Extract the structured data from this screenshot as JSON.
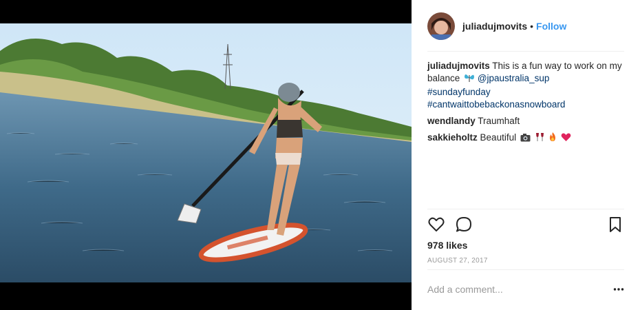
{
  "post": {
    "image_alt": "Woman standing on a paddle board on a lake",
    "author": {
      "username": "juliadujmovits",
      "separator": "•",
      "follow_label": "Follow"
    },
    "caption": {
      "username": "juliadujmovits",
      "text": "This is a fun way to work on my balance",
      "emoji_icon": "butterfly-emoji",
      "mention": "@jpaustralia_sup",
      "hashtags": [
        "#sundayfunday",
        "#cantwaittobebackonasnowboard"
      ]
    },
    "comments": [
      {
        "username": "wendlandy",
        "text": "Traumhaft",
        "emojis": []
      },
      {
        "username": "sakkieholtz",
        "text": "Beautiful",
        "emojis": [
          "camera-flash-emoji",
          "wine-emoji",
          "fire-emoji",
          "heart-emoji"
        ]
      }
    ],
    "actions": {
      "like_icon": "heart-outline-icon",
      "comment_icon": "comment-bubble-icon",
      "save_icon": "bookmark-icon"
    },
    "likes_label": "978 likes",
    "date_label": "AUGUST 27, 2017",
    "add_comment_placeholder": "Add a comment...",
    "more_icon": "more-options-icon"
  },
  "colors": {
    "link": "#003569",
    "follow": "#3897f0",
    "muted": "#999999",
    "text": "#262626"
  }
}
